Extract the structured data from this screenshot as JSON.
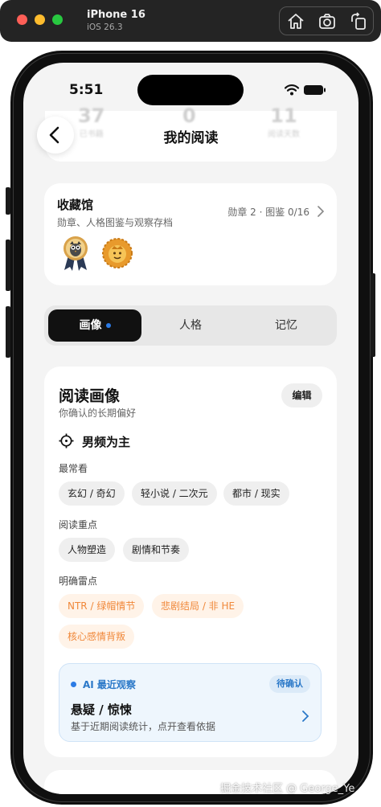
{
  "simulator": {
    "device_name": "iPhone 16",
    "os_version": "iOS 26.3",
    "tools": [
      "home-icon",
      "screenshot-icon",
      "rotate-icon"
    ]
  },
  "status_bar": {
    "time": "5:51"
  },
  "faded_stats": [
    {
      "value": "37",
      "label": "已书籍"
    },
    {
      "value": "0",
      "label": ""
    },
    {
      "value": "11",
      "label": "阅读天数"
    }
  ],
  "nav": {
    "title": "我的阅读"
  },
  "collection": {
    "title": "收藏馆",
    "subtitle": "勋章、人格图鉴与观察存档",
    "meta": "勋章 2 · 图鉴 0/16",
    "badges": [
      "owl-medal-icon",
      "lion-medal-icon"
    ]
  },
  "tabs": [
    {
      "label": "画像",
      "active": true,
      "dot": true
    },
    {
      "label": "人格",
      "active": false
    },
    {
      "label": "记忆",
      "active": false
    }
  ],
  "profile": {
    "title": "阅读画像",
    "subtitle": "你确认的长期偏好",
    "edit_label": "编辑",
    "focus": "男频为主",
    "most_read_label": "最常看",
    "most_read": [
      "玄幻 / 奇幻",
      "轻小说 / 二次元",
      "都市 / 现实"
    ],
    "focus_points_label": "阅读重点",
    "focus_points": [
      "人物塑造",
      "剧情和节奏"
    ],
    "dislikes_label": "明确雷点",
    "dislikes": [
      "NTR / 绿帽情节",
      "悲剧结局 / 非 HE",
      "核心感情背叛"
    ]
  },
  "ai_observation": {
    "label": "AI 最近观察",
    "status": "待确认",
    "title": "悬疑 / 惊悚",
    "description": "基于近期阅读统计，点开查看依据"
  },
  "watermark": "掘金技术社区 @ George_Ye",
  "colors": {
    "accent": "#2c7be5",
    "dislike": "#f0883a",
    "active_tab": "#111111"
  }
}
